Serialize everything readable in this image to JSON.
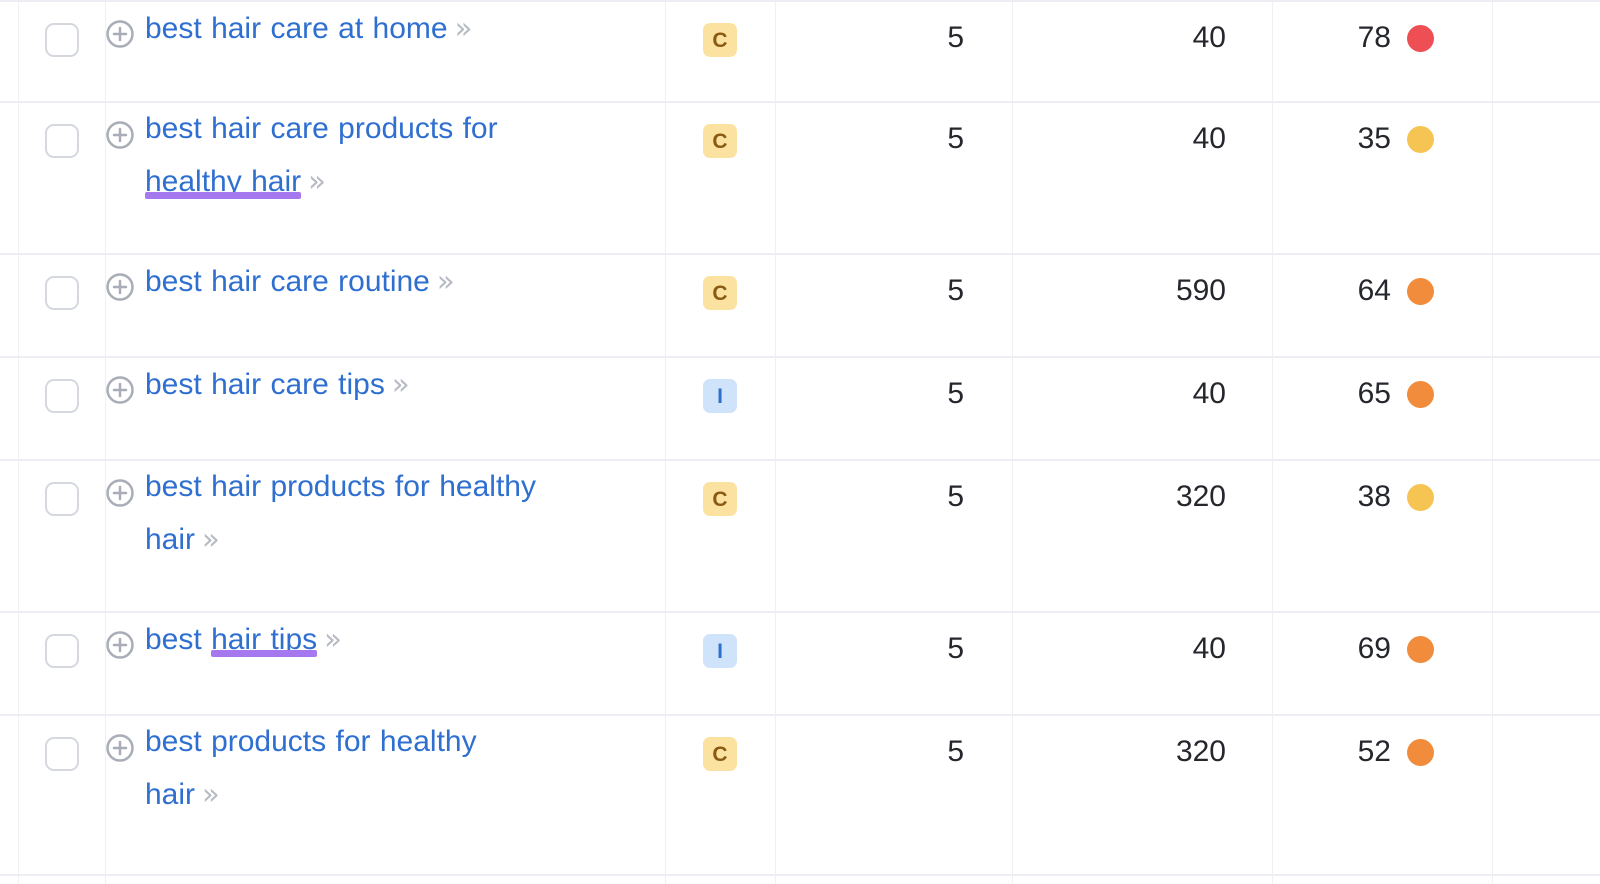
{
  "table": {
    "name": "keyword-ideas-table",
    "columns": [
      "select",
      "keyword",
      "intent",
      "sf",
      "volume",
      "kd"
    ],
    "intent_legend": {
      "C": "Commercial",
      "I": "Informational"
    },
    "colors": {
      "link": "#2f6fd0",
      "chevron": "#b6bac4",
      "row_divider": "#eceef4",
      "col_divider": "#f0f0f4",
      "badge_commercial_bg": "#fbe2a0",
      "badge_commercial_fg": "#8a5a12",
      "badge_informational_bg": "#cfe3fa",
      "badge_informational_fg": "#2f6fd0",
      "highlight_underline": "#a678f0",
      "kd_red": "#ee4f55",
      "kd_orange": "#f08c3c",
      "kd_yellow": "#f5c council"
    },
    "icons": {
      "checkbox": "checkbox-icon",
      "add": "plus-circle-icon",
      "expand": "double-chevron-right-icon"
    },
    "rows": [
      {
        "keyword": "best hair care at home",
        "intent": "C",
        "intent_name": "commercial",
        "sf": "5",
        "volume": "40",
        "kd": "78",
        "kd_color": "#ee4f55",
        "highlight": null
      },
      {
        "keyword": "best hair care products for healthy hair",
        "intent": "C",
        "intent_name": "commercial",
        "sf": "5",
        "volume": "40",
        "kd": "35",
        "kd_color": "#f5c košík"
      }
    ]
  }
}
